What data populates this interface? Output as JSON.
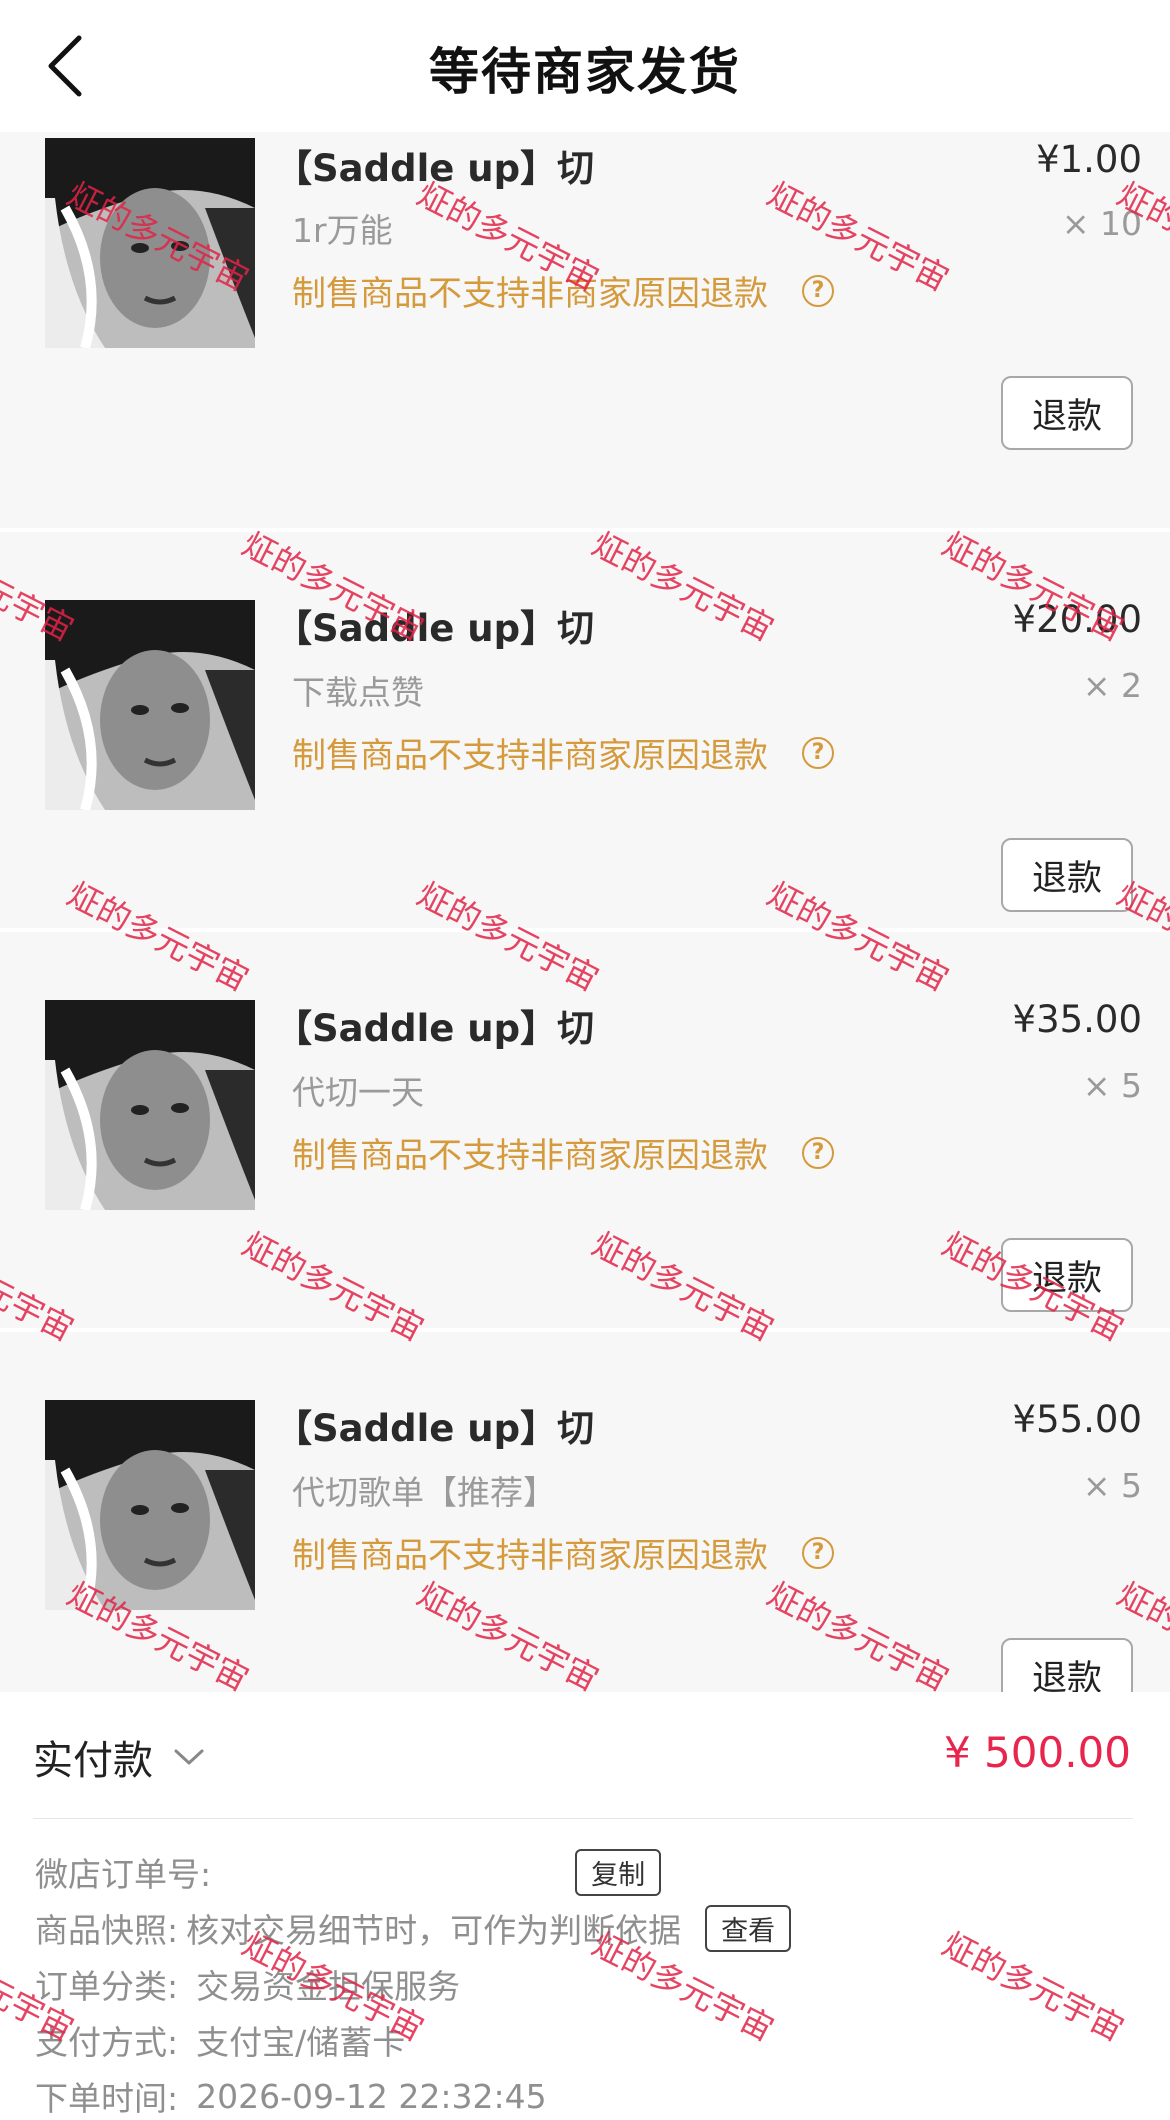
{
  "header": {
    "title": "等待商家发货",
    "back_icon": "chevron-left-icon"
  },
  "items": [
    {
      "title": "【Saddle up】切",
      "spec": "1r万能",
      "price": "¥1.00",
      "qty": "× 10",
      "notice": "制售商品不支持非商家原因退款",
      "help_icon": "question-circle-icon",
      "refund_label": "退款"
    },
    {
      "title": "【Saddle up】切",
      "spec": "下载点赞",
      "price": "¥20.00",
      "qty": "× 2",
      "notice": "制售商品不支持非商家原因退款",
      "help_icon": "question-circle-icon",
      "refund_label": "退款"
    },
    {
      "title": "【Saddle up】切",
      "spec": "代切一天",
      "price": "¥35.00",
      "qty": "× 5",
      "notice": "制售商品不支持非商家原因退款",
      "help_icon": "question-circle-icon",
      "refund_label": "退款"
    },
    {
      "title": "【Saddle up】切",
      "spec": "代切歌单【推荐】",
      "price": "¥55.00",
      "qty": "× 5",
      "notice": "制售商品不支持非商家原因退款",
      "help_icon": "question-circle-icon",
      "refund_label": "退款"
    }
  ],
  "summary": {
    "paid_label": "实付款",
    "paid_amount": "¥ 500.00",
    "order_no_label": "微店订单号:",
    "order_no_value": "",
    "copy_label": "复制",
    "snapshot_label": "商品快照:",
    "snapshot_value": "核对交易细节时，可作为判断依据",
    "view_label": "查看",
    "category_label": "订单分类:",
    "category_value": "交易资金担保服务",
    "payment_label": "支付方式:",
    "payment_value": "支付宝/储蓄卡",
    "time_label": "下单时间:",
    "time_value": "2026-09-12 22:32:45"
  },
  "watermark_text": "炡的多元宇宙",
  "colors": {
    "notice": "#d49a3c",
    "price_total": "#e8254d",
    "watermark": "#e12346",
    "item_bg": "#f7f7f7"
  }
}
